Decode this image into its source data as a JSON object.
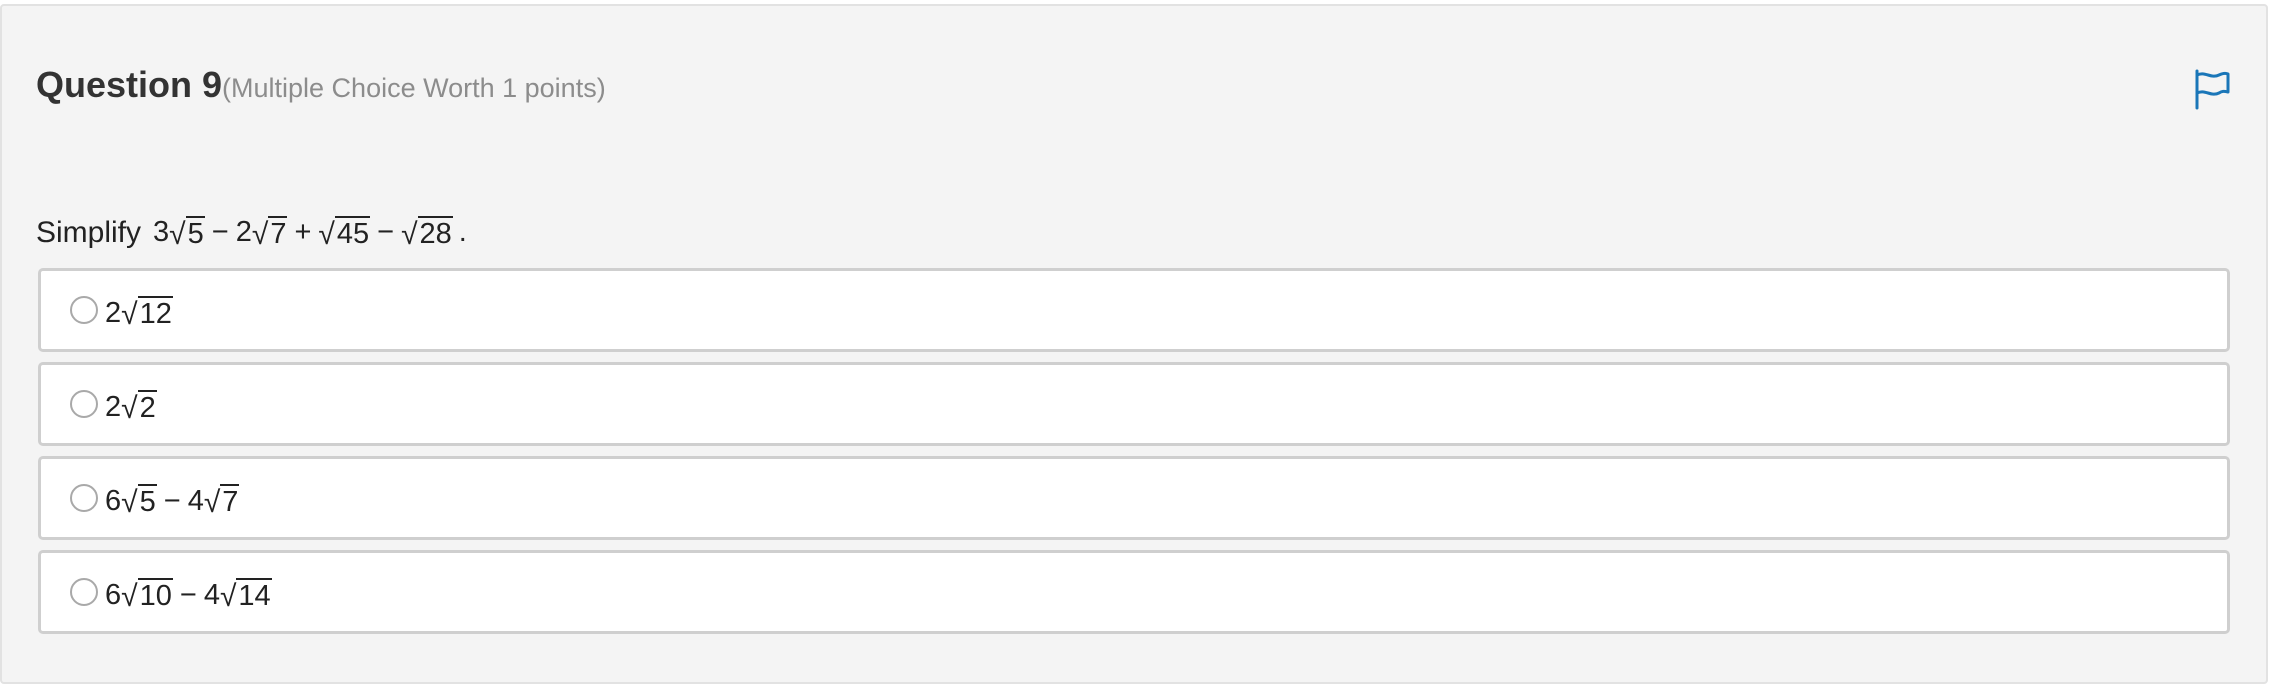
{
  "question": {
    "title": "Question 9",
    "meta": "(Multiple Choice Worth 1 points)",
    "prompt_word": "Simplify",
    "expression": {
      "t1_coef": "3",
      "t1_rad": "5",
      "op1": "−",
      "t2_coef": "2",
      "t2_rad": "7",
      "op2": "+",
      "t3_rad": "45",
      "op3": "−",
      "t4_rad": "28",
      "end": "."
    }
  },
  "icons": {
    "flag": "flag-icon",
    "radical": "√"
  },
  "colors": {
    "panel_bg": "#f4f4f4",
    "flag": "#1a76b8",
    "option_border": "#cfcfcf"
  },
  "options": [
    {
      "coef": "2",
      "rad": "12"
    },
    {
      "coef": "2",
      "rad": "2"
    },
    {
      "coef1": "6",
      "rad1": "5",
      "op": "−",
      "coef2": "4",
      "rad2": "7"
    },
    {
      "coef1": "6",
      "rad1": "10",
      "op": "−",
      "coef2": "4",
      "rad2": "14"
    }
  ]
}
